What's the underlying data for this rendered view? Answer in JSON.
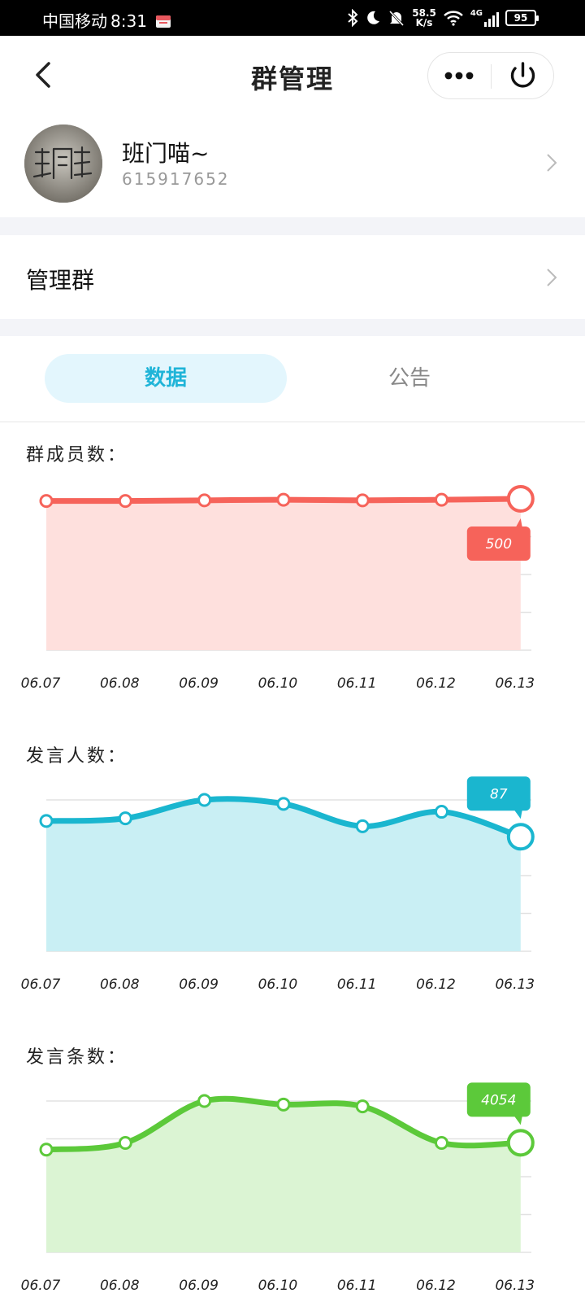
{
  "status_bar": {
    "carrier": "中国移动",
    "time": "8:31",
    "net_speed_value": "58.5",
    "net_speed_unit": "K/s",
    "net_type": "4G",
    "battery": "95"
  },
  "header": {
    "title": "群管理",
    "back_icon": "chevron-left-icon",
    "more_icon": "more-dots-icon",
    "power_icon": "power-icon"
  },
  "profile": {
    "name": "班门喵~",
    "id": "615917652"
  },
  "manage": {
    "label": "管理群"
  },
  "tabs": [
    {
      "label": "数据",
      "active": true
    },
    {
      "label": "公告",
      "active": false
    }
  ],
  "charts": [
    {
      "title": "群成员数：",
      "color": "#f6635a",
      "fill": "#fee0dd",
      "tag_fill": "#f6635a"
    },
    {
      "title": "发言人数：",
      "color": "#1ab6cf",
      "fill": "#c9eff4",
      "tag_fill": "#1ab6cf"
    },
    {
      "title": "发言条数：",
      "color": "#5cc93a",
      "fill": "#dbf4d3",
      "tag_fill": "#5cc93a"
    }
  ],
  "chart_data": [
    {
      "type": "area",
      "categories": [
        "06.07",
        "06.08",
        "06.09",
        "06.10",
        "06.11",
        "06.12",
        "06.13"
      ],
      "values": [
        493,
        493,
        495,
        497,
        495,
        497,
        500
      ],
      "ylim": [
        0,
        500
      ],
      "highlight_label": "500",
      "grid": true
    },
    {
      "type": "area",
      "categories": [
        "06.07",
        "06.08",
        "06.09",
        "06.10",
        "06.11",
        "06.12",
        "06.13"
      ],
      "values": [
        99,
        101,
        115,
        112,
        95,
        106,
        87
      ],
      "ylim": [
        0,
        115
      ],
      "highlight_label": "87",
      "grid": true
    },
    {
      "type": "area",
      "categories": [
        "06.07",
        "06.08",
        "06.09",
        "06.10",
        "06.11",
        "06.12",
        "06.13"
      ],
      "values": [
        3800,
        4050,
        5600,
        5470,
        5400,
        4050,
        4054
      ],
      "ylim": [
        0,
        5600
      ],
      "highlight_label": "4054",
      "grid": true
    }
  ]
}
